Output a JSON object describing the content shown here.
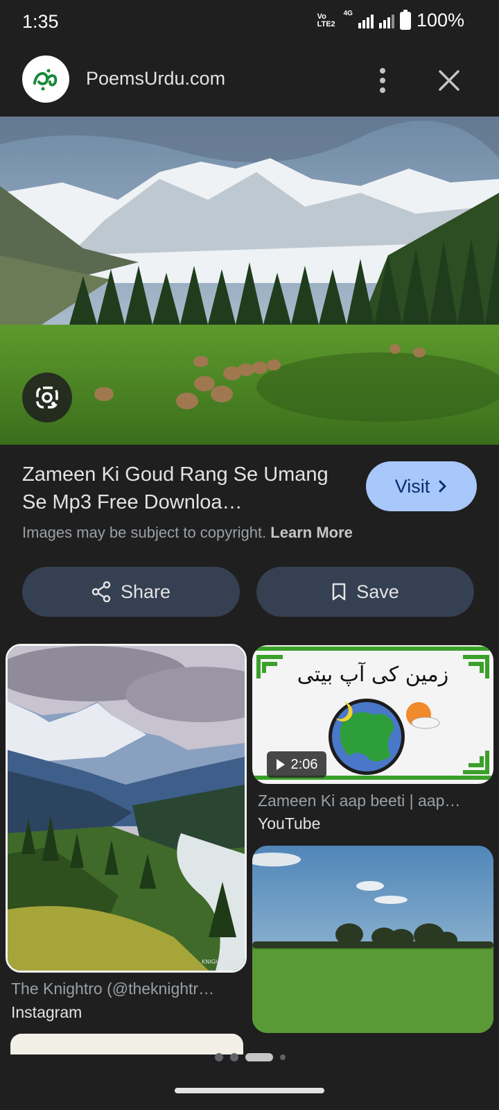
{
  "status_bar": {
    "time": "1:35",
    "volte_label": "Vo LTE2",
    "network": "4G",
    "battery": "100%"
  },
  "header": {
    "site_name": "PoemsUrdu.com",
    "logo_icon": "poems-urdu-logo",
    "more_icon": "more-vert-icon",
    "close_icon": "close-icon"
  },
  "result": {
    "title": "Zameen Ki Goud Rang Se Umang Se Mp3 Free Downloa…",
    "visit_label": "Visit",
    "copyright_text": "Images may be subject to copyright.",
    "learn_more": "Learn More"
  },
  "actions": {
    "share_label": "Share",
    "save_label": "Save"
  },
  "related": [
    {
      "caption": "The Knightro (@theknightr…",
      "source": "Instagram",
      "watermark": "KNIGHTRO"
    },
    {
      "caption": "Zameen Ki aap beeti | aap…",
      "source": "YouTube",
      "duration": "2:06",
      "urdu_title": "زمین کی آپ بیتی"
    },
    {
      "caption": "",
      "source": ""
    }
  ],
  "colors": {
    "background": "#1f1f1f",
    "visit_button": "#a8c7fa",
    "action_button": "#354052"
  },
  "pager": {
    "pages": 4,
    "active": 3
  }
}
